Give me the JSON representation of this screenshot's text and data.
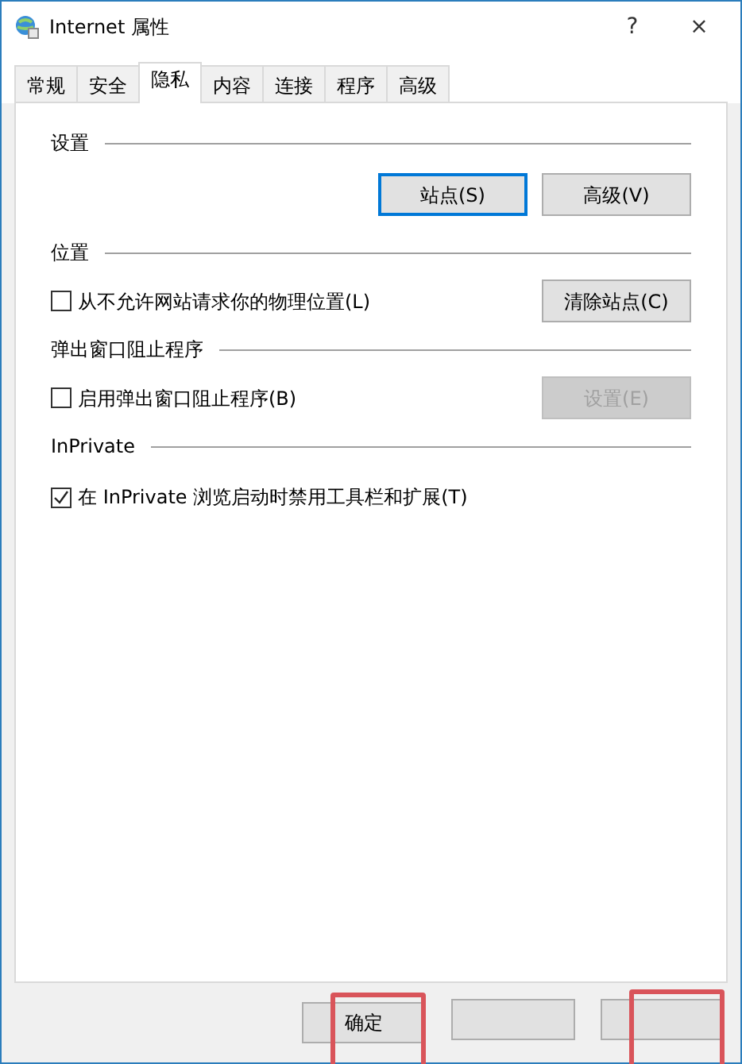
{
  "window": {
    "title": "Internet 属性",
    "help": "?",
    "close": "×"
  },
  "tabs": [
    {
      "label": "常规",
      "selected": false
    },
    {
      "label": "安全",
      "selected": false
    },
    {
      "label": "隐私",
      "selected": true
    },
    {
      "label": "内容",
      "selected": false
    },
    {
      "label": "连接",
      "selected": false
    },
    {
      "label": "程序",
      "selected": false
    },
    {
      "label": "高级",
      "selected": false
    }
  ],
  "sections": [
    {
      "heading": "设置",
      "rows": [
        {
          "kind": "buttons",
          "buttons": [
            {
              "label": "站点(S)",
              "focused": true,
              "disabled": false
            },
            {
              "label": "高级(V)",
              "focused": false,
              "disabled": false
            }
          ]
        }
      ]
    },
    {
      "heading": "位置",
      "rows": [
        {
          "kind": "checkbox",
          "label": "从不允许网站请求你的物理位置(L)",
          "checked": false,
          "button": {
            "label": "清除站点(C)",
            "focused": false,
            "disabled": false
          }
        }
      ]
    },
    {
      "heading": "弹出窗口阻止程序",
      "rows": [
        {
          "kind": "checkbox",
          "label": "启用弹出窗口阻止程序(B)",
          "checked": false,
          "button": {
            "label": "设置(E)",
            "focused": false,
            "disabled": true
          }
        }
      ]
    },
    {
      "heading": "InPrivate",
      "rows": [
        {
          "kind": "checkbox",
          "label": "在 InPrivate 浏览启动时禁用工具栏和扩展(T)",
          "checked": true
        }
      ]
    }
  ],
  "footer_buttons": [
    {
      "label": "确定",
      "highlighted": true
    },
    {
      "highlighted": false
    },
    {
      "highlighted": true
    }
  ]
}
